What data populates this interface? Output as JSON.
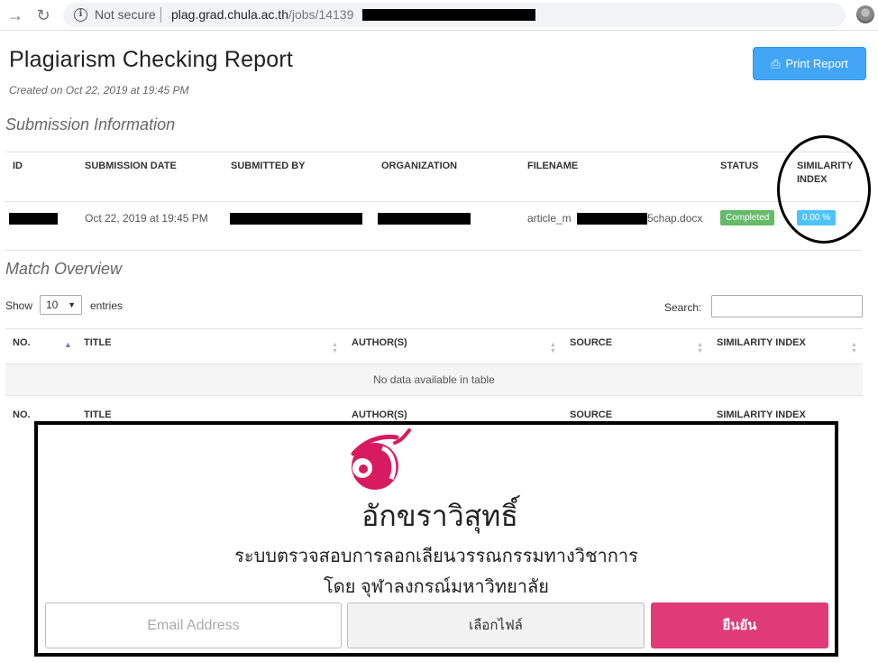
{
  "browser": {
    "security_label": "Not secure",
    "url_host": "plag.grad.chula.ac.th",
    "url_path": "/jobs/14139"
  },
  "header": {
    "title": "Plagiarism Checking Report",
    "created": "Created on Oct 22, 2019 at 19:45 PM",
    "print_label": "Print Report"
  },
  "submission": {
    "section_title": "Submission Information",
    "columns": [
      "ID",
      "SUBMISSION DATE",
      "SUBMITTED BY",
      "ORGANIZATION",
      "FILENAME",
      "STATUS",
      "SIMILARITY INDEX"
    ],
    "row": {
      "date": "Oct 22, 2019 at 19:45 PM",
      "filename_start": "article_m",
      "filename_end": "5chap.docx",
      "status": "Completed",
      "similarity": "0.00 %"
    }
  },
  "match": {
    "section_title": "Match Overview",
    "show_label": "Show",
    "entries_value": "10",
    "entries_label": "entries",
    "search_label": "Search:",
    "columns": [
      "NO.",
      "TITLE",
      "AUTHOR(S)",
      "SOURCE",
      "SIMILARITY INDEX"
    ],
    "empty_message": "No data available in table"
  },
  "overlay": {
    "brand_name": "อักขราวิสุทธิ์",
    "tagline_1": "ระบบตรวจสอบการลอกเลียนวรรณกรรมทางวิชาการ",
    "tagline_2": "โดย จุฬาลงกรณ์มหาวิทยาลัย",
    "email_placeholder": "Email Address",
    "file_button": "เลือกไฟล์",
    "confirm_button": "ยืนยัน"
  },
  "colors": {
    "print_button": "#42a5f5",
    "status_badge": "#66bb6a",
    "similarity_badge": "#4fc3f7",
    "brand_pink": "#d81b60",
    "confirm_button": "#e03b78"
  }
}
